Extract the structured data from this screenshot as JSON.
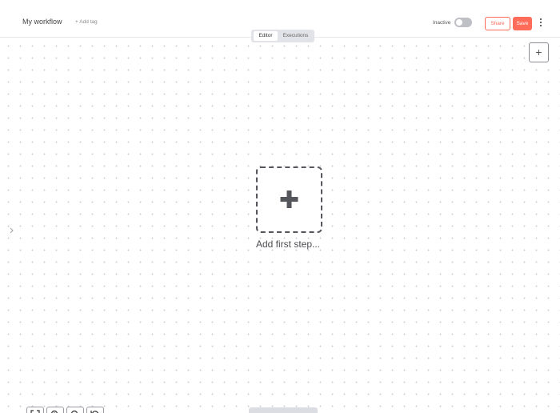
{
  "header": {
    "workflow_name": "My workflow",
    "add_tag_label": "+ Add tag",
    "status_label": "Inactive",
    "active": false,
    "share_label": "Share",
    "save_label": "Save"
  },
  "tabs": [
    {
      "label": "Editor",
      "selected": true
    },
    {
      "label": "Executions",
      "selected": false
    }
  ],
  "canvas": {
    "add_first_step_label": "Add first step..."
  },
  "icons": {
    "more": "vertical-ellipsis-icon",
    "node_creator": "plus-icon",
    "zoom_controls": [
      "fit-view-icon",
      "zoom-in-icon",
      "zoom-out-icon",
      "reset-zoom-icon"
    ]
  },
  "colors": {
    "accent": "#ff6d5a",
    "toggle_off": "#bfbfc6",
    "canvas_dot": "#cfcfd6",
    "tab_bar": "#e2e3e8"
  }
}
